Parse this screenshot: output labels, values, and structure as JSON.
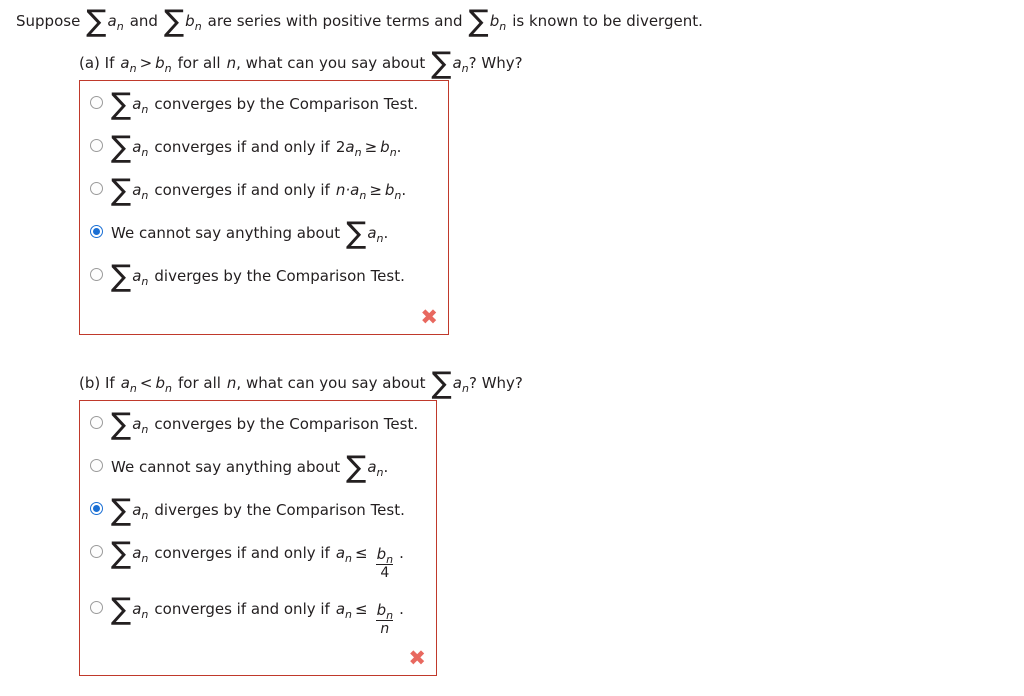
{
  "prompt": {
    "pre": "Suppose",
    "mid": "and",
    "post": "are series with positive terms and",
    "tail": "is known to be divergent.",
    "sum_a": "a",
    "sum_b": "b",
    "sub_n": "n"
  },
  "parts": [
    {
      "id": "a",
      "label_prefix": "(a) If",
      "lhs": "a",
      "relation": ">",
      "rhs": "b",
      "label_mid": "for all",
      "var_n": "n",
      "label_q": ", what can you say about",
      "label_end": "? Why?",
      "status_icon": "cross-icon",
      "status_symbol": "✖",
      "options": [
        {
          "index": 0,
          "selected": false,
          "kind": "sum-first",
          "text": "converges by the Comparison Test."
        },
        {
          "index": 1,
          "selected": false,
          "kind": "sum-first-cond",
          "text": "converges if and only if",
          "cond_coeff": "2",
          "cond_lhs": "a",
          "cond_rel": "≥",
          "cond_rhs": "b",
          "cond_tail": "."
        },
        {
          "index": 2,
          "selected": false,
          "kind": "sum-first-cond",
          "text": "converges if and only if",
          "cond_coeff": "n·",
          "cond_lhs": "a",
          "cond_rel": "≥",
          "cond_rhs": "b",
          "cond_tail": "."
        },
        {
          "index": 3,
          "selected": true,
          "kind": "text-first",
          "text": "We cannot say anything about",
          "tail": "."
        },
        {
          "index": 4,
          "selected": false,
          "kind": "sum-first",
          "text": "diverges by the Comparison Test."
        }
      ]
    },
    {
      "id": "b",
      "label_prefix": "(b) If",
      "lhs": "a",
      "relation": "<",
      "rhs": "b",
      "label_mid": "for all",
      "var_n": "n",
      "label_q": ", what can you say about",
      "label_end": "? Why?",
      "status_icon": "cross-icon",
      "status_symbol": "✖",
      "options": [
        {
          "index": 0,
          "selected": false,
          "kind": "sum-first",
          "text": "converges by the Comparison Test."
        },
        {
          "index": 1,
          "selected": false,
          "kind": "text-first",
          "text": "We cannot say anything about",
          "tail": "."
        },
        {
          "index": 2,
          "selected": true,
          "kind": "sum-first",
          "text": "diverges by the Comparison Test."
        },
        {
          "index": 3,
          "selected": false,
          "kind": "sum-first-frac",
          "text": "converges if and only if",
          "cond_lhs": "a",
          "cond_rel": "≤",
          "frac_num": "b",
          "frac_num_sub": "n",
          "frac_den": "4",
          "frac_den_italic": false,
          "cond_tail": "."
        },
        {
          "index": 4,
          "selected": false,
          "kind": "sum-first-frac",
          "text": "converges if and only if",
          "cond_lhs": "a",
          "cond_rel": "≤",
          "frac_num": "b",
          "frac_num_sub": "n",
          "frac_den": "n",
          "frac_den_italic": true,
          "cond_tail": "."
        }
      ]
    }
  ],
  "colors": {
    "box_border": "#c0392b",
    "selected_radio": "#1a6fd4",
    "unselected_radio": "#9b9b9b",
    "wrong_mark": "#e8685f",
    "text": "#231f20",
    "background": "#ffffff"
  },
  "sigma_glyph": "∑"
}
